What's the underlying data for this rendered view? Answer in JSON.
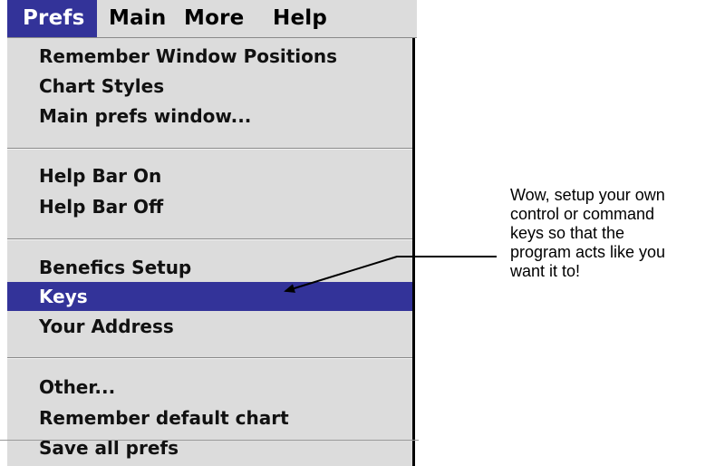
{
  "menubar": {
    "items": [
      {
        "label": "Prefs",
        "active": true
      },
      {
        "label": "Main",
        "active": false
      },
      {
        "label": "More",
        "active": false
      },
      {
        "label": "Help",
        "active": false
      }
    ]
  },
  "dropdown": {
    "groups": [
      {
        "items": [
          {
            "label": "Remember Window Positions"
          },
          {
            "label": "Chart Styles"
          },
          {
            "label": "Main prefs window..."
          }
        ]
      },
      {
        "items": [
          {
            "label": "Help Bar On"
          },
          {
            "label": "Help Bar Off"
          }
        ]
      },
      {
        "items": [
          {
            "label": "Benefics Setup"
          },
          {
            "label": "Keys",
            "selected": true
          },
          {
            "label": "Your Address"
          }
        ]
      },
      {
        "items": [
          {
            "label": "Other..."
          },
          {
            "label": "Remember default chart"
          },
          {
            "label": "Save all prefs"
          }
        ]
      }
    ]
  },
  "annotation": {
    "lines": [
      "Wow, setup your own",
      "control or command",
      "keys so that the",
      "program acts like you",
      "want it to!"
    ]
  },
  "colors": {
    "menu_background": "#dcdcdc",
    "highlight": "#333399",
    "highlight_text": "#ffffff",
    "separator": "#8a8a8a"
  }
}
